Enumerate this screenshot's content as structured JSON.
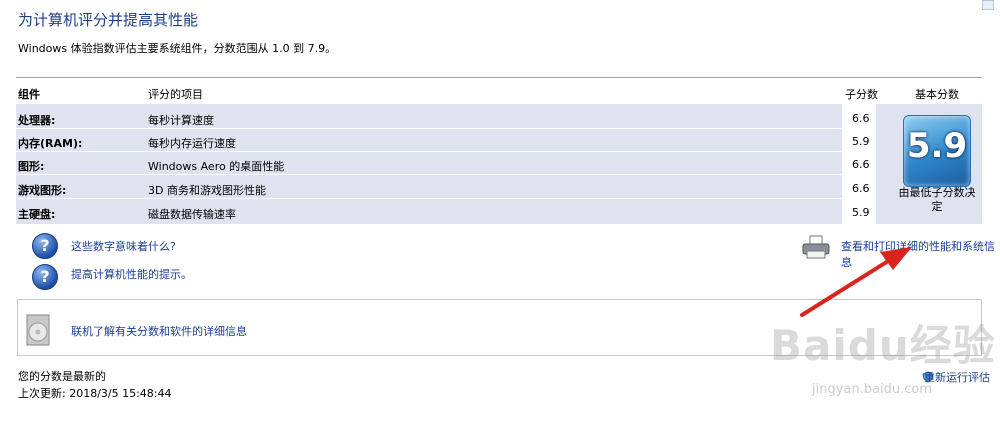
{
  "title": "为计算机评分并提高其性能",
  "subtitle": "Windows 体验指数评估主要系统组件，分数范围从 1.0 到 7.9。",
  "table": {
    "headers": {
      "component": "组件",
      "item": "评分的项目",
      "subscore": "子分数",
      "basescore": "基本分数"
    },
    "rows": [
      {
        "component": "处理器:",
        "item": "每秒计算速度",
        "subscore": "6.6"
      },
      {
        "component": "内存(RAM):",
        "item": "每秒内存运行速度",
        "subscore": "5.9"
      },
      {
        "component": "图形:",
        "item": "Windows Aero 的桌面性能",
        "subscore": "6.6"
      },
      {
        "component": "游戏图形:",
        "item": "3D 商务和游戏图形性能",
        "subscore": "6.6"
      },
      {
        "component": "主硬盘:",
        "item": "磁盘数据传输速率",
        "subscore": "5.9"
      }
    ],
    "base_score": "5.9",
    "base_note": "由最低子分数决定"
  },
  "links": {
    "meaning": "这些数字意味着什么?",
    "tips": "提高计算机性能的提示。",
    "print": "查看和打印详细的性能和系统信息",
    "online": "联机了解有关分数和软件的详细信息"
  },
  "status": {
    "current": "您的分数是最新的",
    "last_update": "上次更新: 2018/3/5 15:48:44",
    "rerun": "重新运行评估"
  },
  "watermark": {
    "logo": "Baidu经验",
    "url": "jingyan.baidu.com"
  },
  "icons": {
    "help": "question-icon",
    "printer": "printer-icon",
    "online": "cd-icon",
    "rerun": "refresh-shield-icon"
  },
  "colors": {
    "title": "#1e3f86",
    "link": "#1a3e97",
    "row_bg": "#dfe3ef",
    "arrow": "#d9261c"
  }
}
